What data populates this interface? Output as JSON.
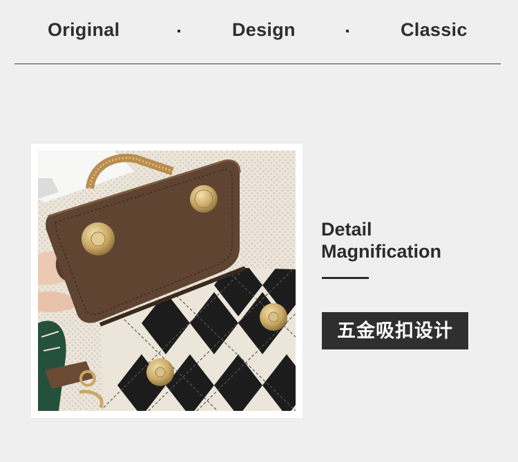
{
  "header": {
    "words": [
      "Original",
      "Design",
      "Classic"
    ]
  },
  "photo": {
    "icon": "handbag-closeup-photo"
  },
  "detail": {
    "title_line1": "Detail",
    "title_line2": "Magnification",
    "badge_text": "五金吸扣设计"
  },
  "colors": {
    "background": "#efefef",
    "text": "#2b2b2b",
    "badge_bg": "#2f2f2f",
    "badge_text": "#ffffff",
    "leather_brown": "#5e4431",
    "gold_hardware": "#c9a866"
  }
}
